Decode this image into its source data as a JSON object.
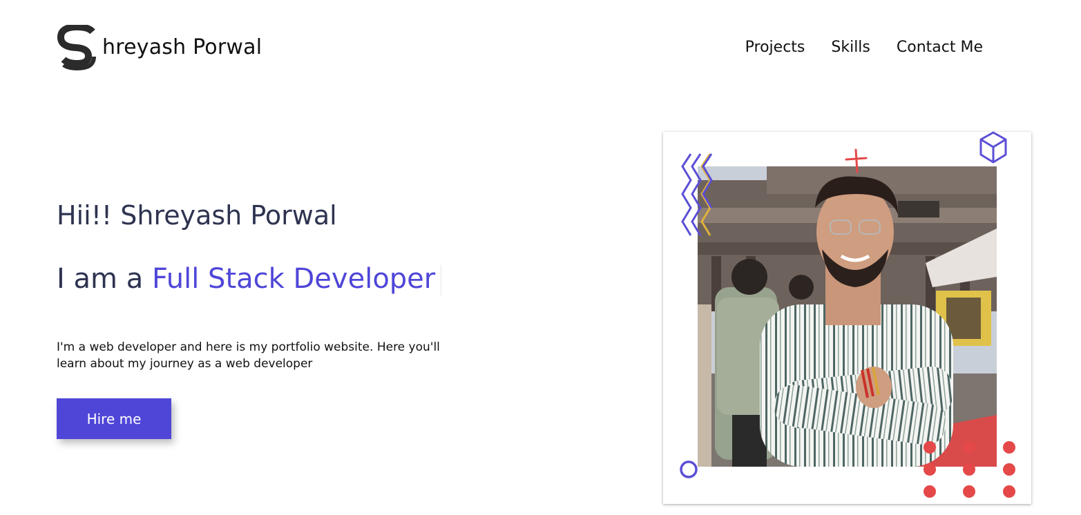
{
  "header": {
    "logo_text": "hreyash Porwal",
    "logo_icon": "s-monogram-icon",
    "nav": [
      {
        "label": "Projects"
      },
      {
        "label": "Skills"
      },
      {
        "label": "Contact Me"
      }
    ]
  },
  "hero": {
    "greeting": "Hii!! Shreyash Porwal",
    "role_prefix": "I am a ",
    "role": "Full Stack Developer",
    "intro": "I'm a web developer and here is my portfolio website. Here you'll learn about my journey as a web developer",
    "cta_label": "Hire me"
  },
  "colors": {
    "accent": "#4f46d8",
    "text_dark": "#2e3350",
    "deco_red": "#e54848",
    "deco_purple": "#5b4fd6"
  }
}
